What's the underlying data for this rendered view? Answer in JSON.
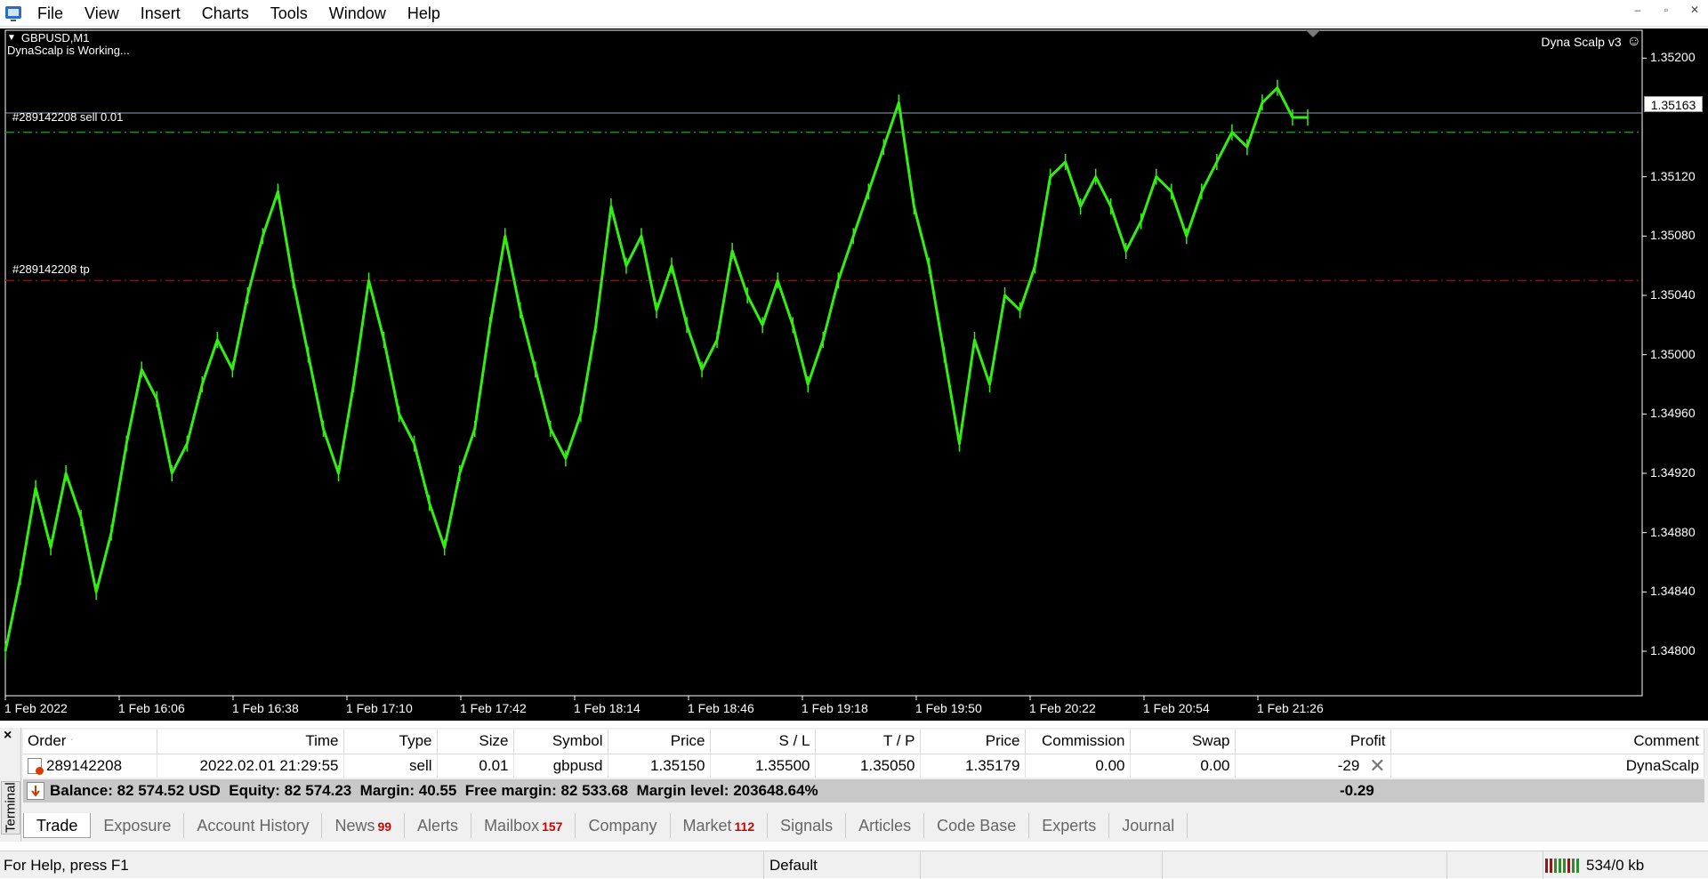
{
  "menu": {
    "items": [
      "File",
      "View",
      "Insert",
      "Charts",
      "Tools",
      "Window",
      "Help"
    ],
    "window_controls": [
      "–",
      "▫",
      "✕"
    ]
  },
  "chart": {
    "symbol": "GBPUSD,M1",
    "status": "DynaScalp is Working...",
    "ea_name": "Dyna Scalp v3",
    "current_price": "1.35163",
    "sell_line_label": "#289142208 sell 0.01",
    "tp_line_label": "#289142208 tp",
    "colors": {
      "background": "#000000",
      "candles": "#33ee11",
      "sell_line": "#2a8a2a",
      "tp_line": "#b00000",
      "bid_line": "#8fa3b7"
    }
  },
  "chart_data": {
    "type": "line",
    "title": "",
    "series": [
      {
        "values": [
          1.348,
          1.3485,
          1.3491,
          1.3487,
          1.3492,
          1.3489,
          1.3484,
          1.3488,
          1.3494,
          1.3499,
          1.3497,
          1.3492,
          1.3494,
          1.3498,
          1.3501,
          1.3499,
          1.3504,
          1.3508,
          1.3511,
          1.3505,
          1.35,
          1.3495,
          1.3492,
          1.3498,
          1.3505,
          1.3501,
          1.3496,
          1.3494,
          1.349,
          1.3487,
          1.3492,
          1.3495,
          1.3502,
          1.3508,
          1.3503,
          1.3499,
          1.3495,
          1.3493,
          1.3496,
          1.3502,
          1.351,
          1.3506,
          1.3508,
          1.3503,
          1.3506,
          1.3502,
          1.3499,
          1.3501,
          1.3507,
          1.3504,
          1.3502,
          1.3505,
          1.3502,
          1.3498,
          1.3501,
          1.3505,
          1.3508,
          1.3511,
          1.3514,
          1.3517,
          1.351,
          1.3506,
          1.35,
          1.3494,
          1.3501,
          1.3498,
          1.3504,
          1.3503,
          1.3506,
          1.3512,
          1.3513,
          1.351,
          1.3512,
          1.351,
          1.3507,
          1.3509,
          1.3512,
          1.3511,
          1.3508,
          1.3511,
          1.3513,
          1.3515,
          1.3514,
          1.3517,
          1.3518,
          1.3516,
          1.3516
        ]
      }
    ],
    "x_ticks": [
      "1 Feb 2022",
      "1 Feb 16:06",
      "1 Feb 16:38",
      "1 Feb 17:10",
      "1 Feb 17:42",
      "1 Feb 18:14",
      "1 Feb 18:46",
      "1 Feb 19:18",
      "1 Feb 19:50",
      "1 Feb 20:22",
      "1 Feb 20:54",
      "1 Feb 21:26"
    ],
    "y_ticks": [
      "1.35200",
      "1.35120",
      "1.35080",
      "1.35040",
      "1.35000",
      "1.34960",
      "1.34920",
      "1.34880",
      "1.34840",
      "1.34800"
    ],
    "ylim": [
      1.3477,
      1.3522
    ],
    "levels": {
      "bid": 1.35163,
      "sell": 1.3515,
      "tp": 1.3505
    },
    "grid": false
  },
  "terminal": {
    "title": "Terminal",
    "columns": [
      "Order",
      "Time",
      "Type",
      "Size",
      "Symbol",
      "Price",
      "S / L",
      "T / P",
      "Price",
      "Commission",
      "Swap",
      "Profit",
      "Comment"
    ],
    "rows": [
      {
        "order": "289142208",
        "time": "2022.02.01 21:29:55",
        "type": "sell",
        "size": "0.01",
        "symbol": "gbpusd",
        "price": "1.35150",
        "sl": "1.35500",
        "tp": "1.35050",
        "current_price": "1.35179",
        "commission": "0.00",
        "swap": "0.00",
        "profit": "-29",
        "comment": "DynaScalp"
      }
    ],
    "balance": {
      "text": "Balance: 82 574.52 USD  Equity: 82 574.23  Margin: 40.55  Free margin: 82 533.68  Margin level: 203648.64%",
      "profit": "-0.29"
    },
    "tabs": [
      {
        "label": "Trade",
        "badge": ""
      },
      {
        "label": "Exposure",
        "badge": ""
      },
      {
        "label": "Account History",
        "badge": ""
      },
      {
        "label": "News",
        "badge": "99"
      },
      {
        "label": "Alerts",
        "badge": ""
      },
      {
        "label": "Mailbox",
        "badge": "157"
      },
      {
        "label": "Company",
        "badge": ""
      },
      {
        "label": "Market",
        "badge": "112"
      },
      {
        "label": "Signals",
        "badge": ""
      },
      {
        "label": "Articles",
        "badge": ""
      },
      {
        "label": "Code Base",
        "badge": ""
      },
      {
        "label": "Experts",
        "badge": ""
      },
      {
        "label": "Journal",
        "badge": ""
      }
    ]
  },
  "status": {
    "help": "For Help, press F1",
    "profile": "Default",
    "traffic": "534/0 kb"
  }
}
